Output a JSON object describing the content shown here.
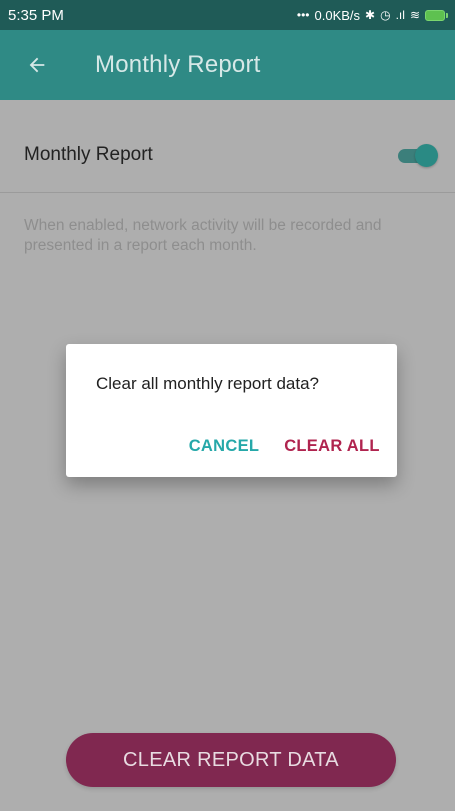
{
  "status_bar": {
    "time": "5:35 PM",
    "network_speed": "0.0KB/s",
    "icons": [
      "more-dots-icon",
      "bluetooth-icon",
      "alarm-icon",
      "signal-icon",
      "wifi-icon",
      "battery-icon"
    ],
    "more_glyph": "•••",
    "bluetooth_glyph": "✱",
    "alarm_glyph": "◷",
    "signal_glyph": ".ıl",
    "wifi_glyph": "≋"
  },
  "app_bar": {
    "title": "Monthly Report",
    "back_icon": "arrow-back-icon",
    "color": "#2f8a85"
  },
  "setting": {
    "label": "Monthly Report",
    "toggle_on": true,
    "description": "When enabled, network activity will be recorded and presented in a report each month."
  },
  "dialog": {
    "message": "Clear all monthly report data?",
    "cancel_label": "CANCEL",
    "confirm_label": "CLEAR ALL",
    "cancel_color": "#26a8a9",
    "confirm_color": "#b0244f"
  },
  "bottom_button": {
    "label": "CLEAR REPORT DATA",
    "color": "#802850"
  }
}
